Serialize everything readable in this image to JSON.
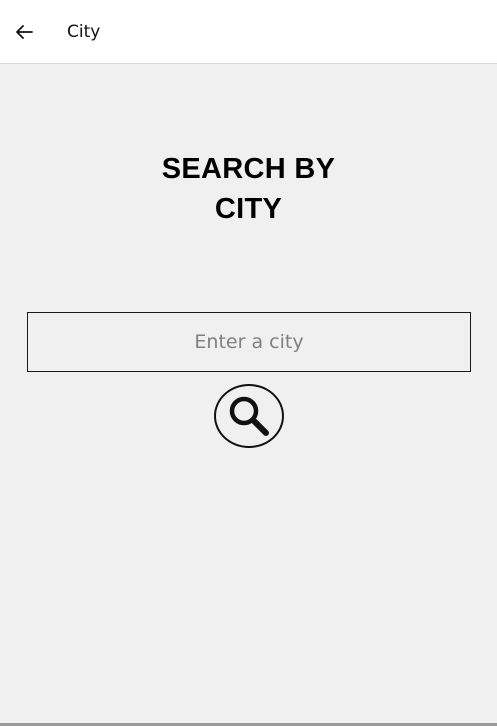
{
  "header": {
    "back_icon": "arrow-left-icon",
    "title": "City"
  },
  "main": {
    "heading_line1": "SEARCH BY",
    "heading_line2": "CITY",
    "search_input": {
      "value": "",
      "placeholder": "Enter a city"
    },
    "search_button_icon": "magnifier-icon"
  },
  "colors": {
    "header_background": "#ffffff",
    "page_background": "#f0f0f0",
    "text": "#000000",
    "placeholder": "#808080"
  }
}
